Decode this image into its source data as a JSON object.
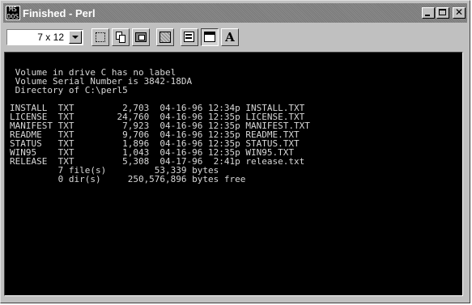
{
  "window": {
    "title": "Finished - Perl",
    "icon_text_top": "MS",
    "icon_text_bottom": "DOS"
  },
  "toolbar": {
    "font_size": "7 x 12",
    "buttons": [
      {
        "name": "mark-icon"
      },
      {
        "name": "copy-icon"
      },
      {
        "name": "paste-icon"
      },
      {
        "name": "full-screen-icon"
      },
      {
        "name": "properties-icon"
      },
      {
        "name": "background-icon"
      },
      {
        "name": "font-icon",
        "label": "A"
      }
    ]
  },
  "console": {
    "lines": [
      "",
      " Volume in drive C has no label",
      " Volume Serial Number is 3842-18DA",
      " Directory of C:\\perl5",
      "",
      "INSTALL  TXT         2,703  04-16-96 12:34p INSTALL.TXT",
      "LICENSE  TXT        24,760  04-16-96 12:35p LICENSE.TXT",
      "MANIFEST TXT         7,923  04-16-96 12:35p MANIFEST.TXT",
      "README   TXT         9,706  04-16-96 12:35p README.TXT",
      "STATUS   TXT         1,896  04-16-96 12:35p STATUS.TXT",
      "WIN95    TXT         1,043  04-16-96 12:35p WIN95.TXT",
      "RELEASE  TXT         5,308  04-17-96  2:41p release.txt",
      "         7 file(s)         53,339 bytes",
      "         0 dir(s)     250,576,896 bytes free"
    ]
  },
  "colors": {
    "console_bg": "#000000",
    "console_fg": "#d8d8d8",
    "chrome": "#c0c0c0"
  }
}
